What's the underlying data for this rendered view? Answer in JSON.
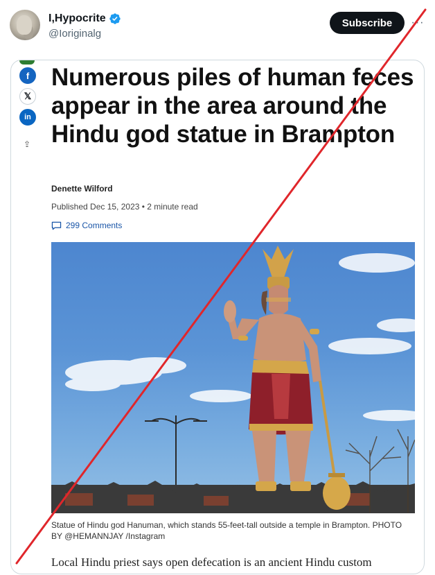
{
  "tweet": {
    "display_name": "I,Hypocrite",
    "handle": "@Ioriginalg",
    "subscribe_label": "Subscribe",
    "more_label": "···"
  },
  "share": {
    "facebook_glyph": "f",
    "x_glyph": "𝕏",
    "linkedin_glyph": "in",
    "share_glyph": "⇪"
  },
  "article": {
    "headline": "Numerous piles of human feces appear in the area around the Hindu god statue in Brampton",
    "author": "Denette Wilford",
    "published": "Published Dec 15, 2023  •  2 minute read",
    "comments": "299 Comments",
    "caption": "Statue of Hindu god Hanuman, which stands 55-feet-tall outside a temple in Brampton. PHOTO BY @HEMANNJAY /Instagram",
    "lede": "Local Hindu priest says open defecation is an ancient Hindu custom"
  },
  "colors": {
    "accent_blue": "#1d9bf0",
    "subscribe_bg": "#0f1419",
    "strike_line": "#e0262b",
    "link_blue": "#1a56a8"
  }
}
